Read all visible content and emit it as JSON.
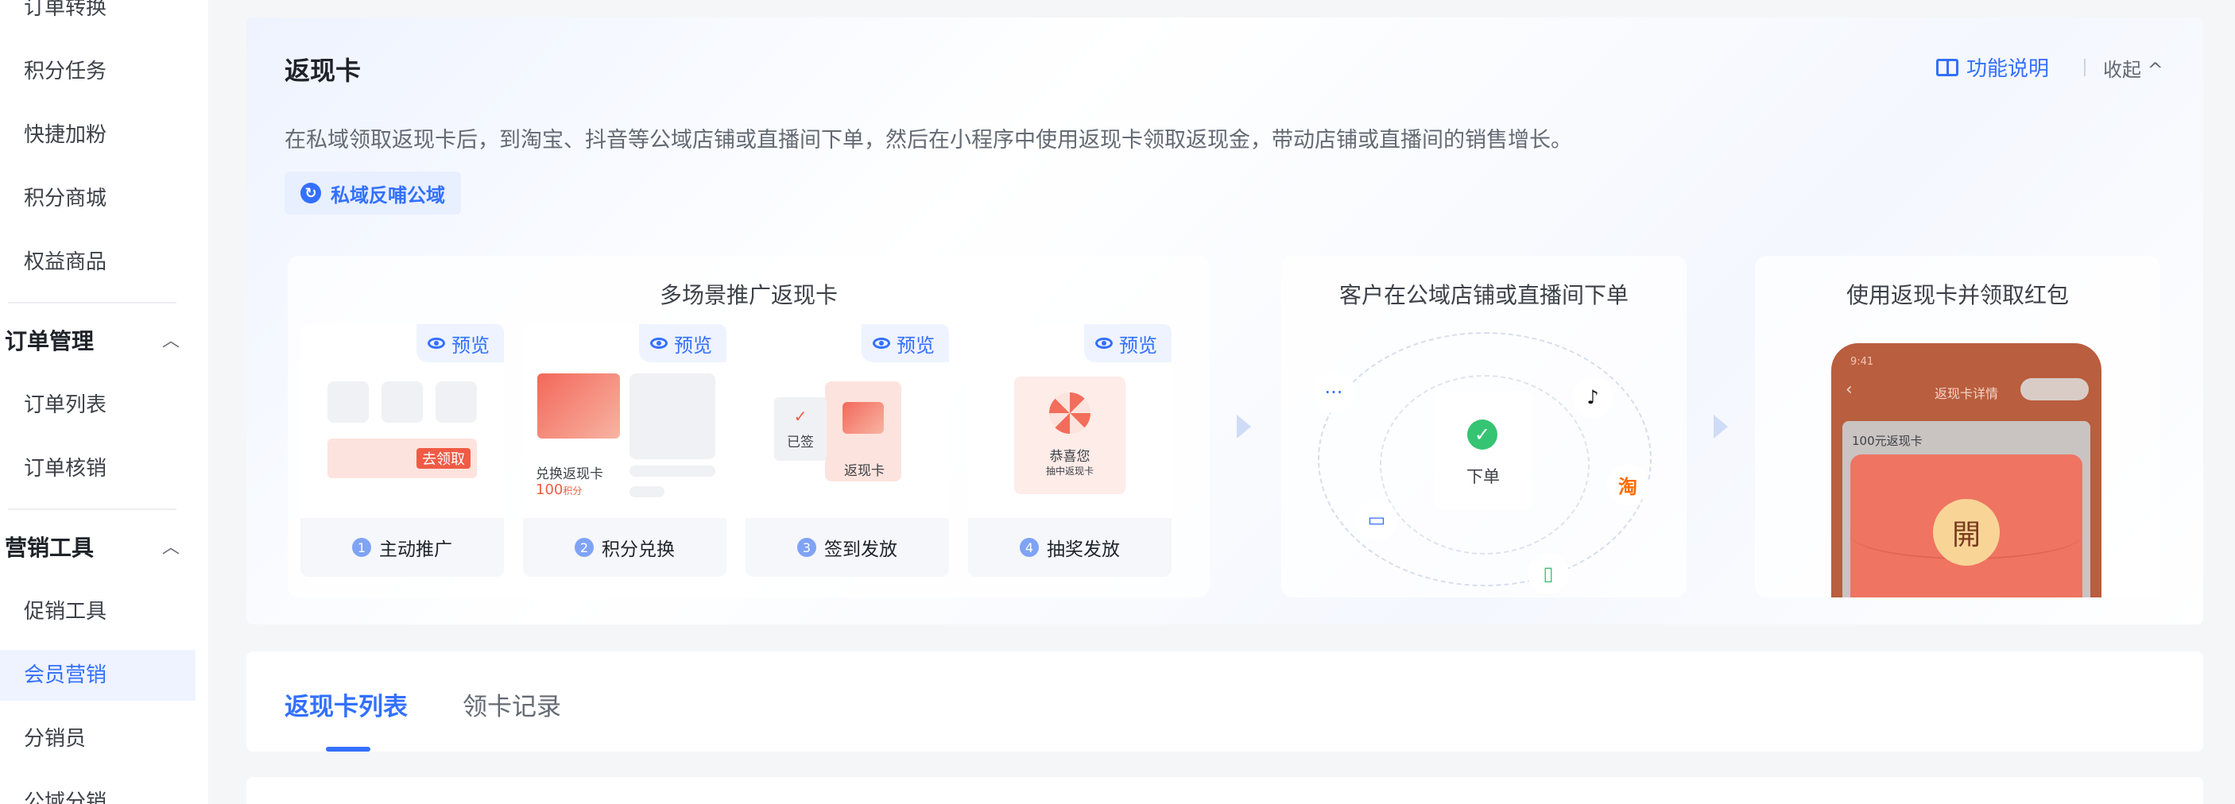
{
  "sidebar": {
    "items_top": [
      "订单转换",
      "积分任务",
      "快捷加粉",
      "积分商城",
      "权益商品"
    ],
    "group_order": "订单管理",
    "items_order": [
      "订单列表",
      "订单核销"
    ],
    "group_marketing": "营销工具",
    "items_marketing": [
      "促销工具",
      "会员营销",
      "分销员",
      "公域分销"
    ]
  },
  "header": {
    "title": "返现卡",
    "feature_link": "功能说明",
    "collapse": "收起 ^",
    "description": "在私域领取返现卡后，到淘宝、抖音等公域店铺或直播间下单，然后在小程序中使用返现卡领取返现金，带动店铺或直播间的销售增长。",
    "tag": "私域反哺公域"
  },
  "flow": {
    "panel1_title": "多场景推广返现卡",
    "preview_label": "预览",
    "scenes": [
      {
        "num": "1",
        "label": "主动推广",
        "btn": "去领取"
      },
      {
        "num": "2",
        "label": "积分兑换",
        "card_text": "兑换返现卡",
        "points": "100",
        "points_unit": "积分"
      },
      {
        "num": "3",
        "label": "签到发放",
        "signed": "已签",
        "card_text": "返现卡"
      },
      {
        "num": "4",
        "label": "抽奖发放",
        "congrats": "恭喜您",
        "win_text": "抽中返现卡"
      }
    ],
    "panel2_title": "客户在公域店铺或直播间下单",
    "order_label": "下单",
    "panel3_title": "使用返现卡并领取红包",
    "phone": {
      "time": "9:41",
      "title": "返现卡详情",
      "card_label": "100元返现卡",
      "open_char": "開"
    }
  },
  "tabs": {
    "list": "返现卡列表",
    "records": "领卡记录"
  },
  "colors": {
    "accent": "#3370ff",
    "red": "#ef5b45"
  }
}
